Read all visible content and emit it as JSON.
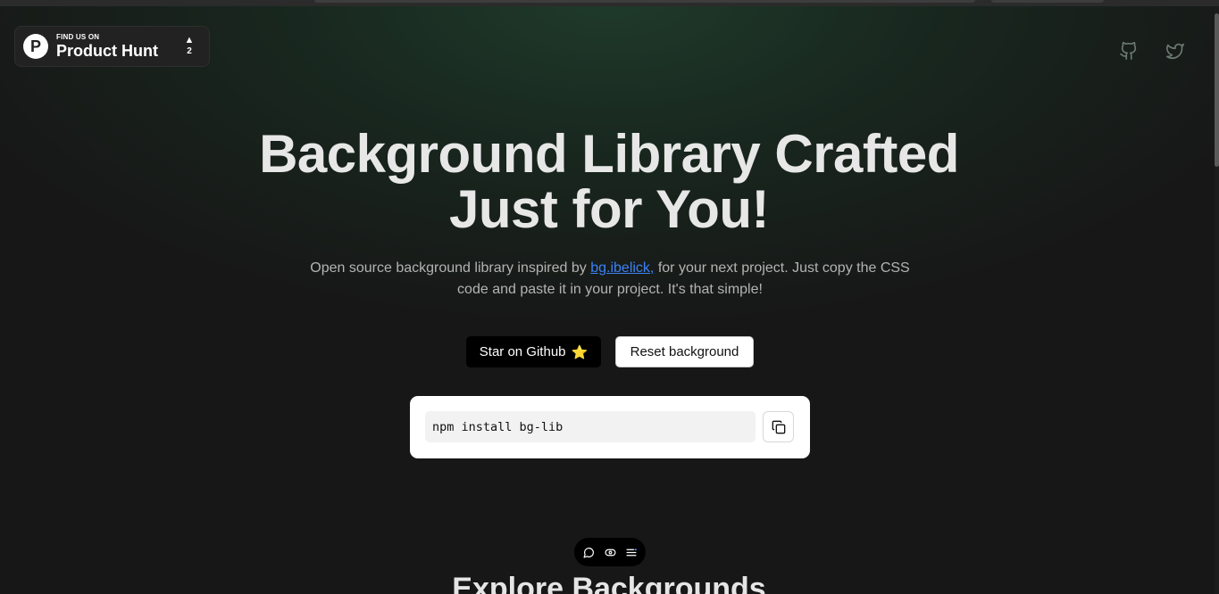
{
  "product_hunt": {
    "small_text": "FIND US ON",
    "name": "Product Hunt",
    "upvotes": "2",
    "logo_letter": "P"
  },
  "social": {
    "github_icon": "github-icon",
    "twitter_icon": "twitter-icon"
  },
  "hero": {
    "title_line1": "Background Library Crafted",
    "title_line2": "Just for You!",
    "subtitle_before": "Open source background library inspired by ",
    "subtitle_link": "bg.ibelick,",
    "subtitle_after": " for your next project. Just copy the CSS code and paste it in your project. It's that simple!"
  },
  "buttons": {
    "star_label": "Star on Github",
    "star_emoji": "⭐",
    "reset_label": "Reset background"
  },
  "install": {
    "command": "npm install bg-lib",
    "copy_icon": "copy-icon"
  },
  "toolbar": {
    "icons": [
      "chat-icon",
      "toggle-icon",
      "menu-icon"
    ]
  },
  "section": {
    "heading": "Explore Backgrounds"
  },
  "colors": {
    "link": "#3b82f6",
    "accent_green": "#1f3a2a"
  }
}
